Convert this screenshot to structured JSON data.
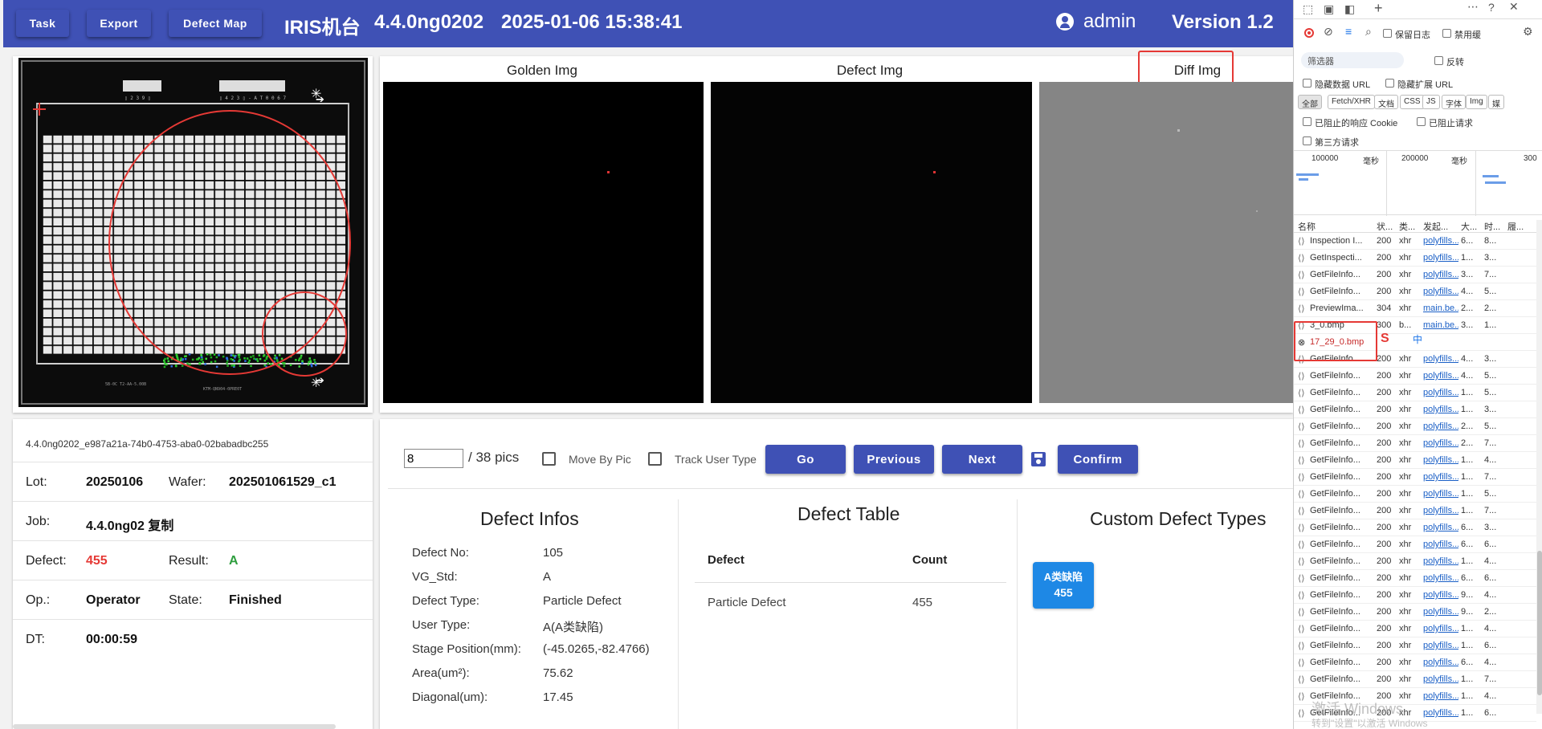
{
  "topbar": {
    "task_label": "Task",
    "export_label": "Export",
    "defect_map_label": "Defect Map",
    "machine": "IRIS机台",
    "recipe": "4.4.0ng0202",
    "datetime": "2025-01-06 15:38:41",
    "user": "admin",
    "version": "Version 1.2",
    "bg_color": "#3f51b5"
  },
  "wafer": {
    "barcode_left": "▯ 2 3 9 ▯",
    "barcode_right": "▯ 4 2 3 ▯ - A T 0 0 6 7",
    "bottom_left": "5B-0C T2-AA-5.00B",
    "bottom_right": "KTM-QN904-0PRE0T"
  },
  "viewer": {
    "golden_title": "Golden Img",
    "defect_title": "Defect Img",
    "diff_title": "Diff Img"
  },
  "info": {
    "id": "4.4.0ng0202_e987a21a-74b0-4753-aba0-02babadbc255",
    "lot_label": "Lot:",
    "lot": "20250106",
    "wafer_label": "Wafer:",
    "wafer": "202501061529_c1",
    "job_label": "Job:",
    "job": "4.4.0ng02 复制",
    "defect_label": "Defect:",
    "defect": "455",
    "result_label": "Result:",
    "result": "A",
    "op_label": "Op.:",
    "op": "Operator",
    "state_label": "State:",
    "state": "Finished",
    "dt_label": "DT:",
    "dt": "00:00:59",
    "defect_color": "#e53935",
    "result_color": "#2e9e3e"
  },
  "controls": {
    "pic_value": "8",
    "pic_total": "/ 38 pics",
    "move_by_pic": "Move By Pic",
    "track_user_type": "Track User Type",
    "go": "Go",
    "previous": "Previous",
    "next": "Next",
    "confirm": "Confirm"
  },
  "defect_infos": {
    "title": "Defect Infos",
    "rows": [
      {
        "label": "Defect No:",
        "value": "105"
      },
      {
        "label": "VG_Std:",
        "value": "A"
      },
      {
        "label": "Defect Type:",
        "value": "Particle Defect"
      },
      {
        "label": "User Type:",
        "value": "A(A类缺陷)"
      },
      {
        "label": "Stage Position(mm):",
        "value": "(-45.0265,-82.4766)"
      },
      {
        "label": "Area(um²):",
        "value": "75.62"
      },
      {
        "label": "Diagonal(um):",
        "value": "17.45"
      }
    ]
  },
  "defect_table": {
    "title": "Defect Table",
    "col_defect": "Defect",
    "col_count": "Count",
    "rows": [
      {
        "defect": "Particle Defect",
        "count": "455"
      }
    ]
  },
  "custom_types": {
    "title": "Custom Defect Types",
    "chip_name": "A类缺陷",
    "chip_count": "455",
    "chip_color": "#1e88e5"
  },
  "devtools": {
    "filter_placeholder": "筛选器",
    "invert": "反转",
    "preserve_log": "保留日志",
    "disable_cache": "禁用缓",
    "hide_data_url": "隐藏数据 URL",
    "hide_ext_url": "隐藏扩展 URL",
    "chips": [
      "全部",
      "Fetch/XHR",
      "文档",
      "CSS",
      "JS",
      "字体",
      "Img",
      "媒"
    ],
    "blocked_cookie": "已阻止的响应 Cookie",
    "blocked_req": "已阻止请求",
    "third_party": "第三方请求",
    "tl_1": "100000",
    "tl_2": "200000",
    "tl_3": "300",
    "tl_unit": "毫秒",
    "cols": {
      "name": "名称",
      "status": "状...",
      "type": "类...",
      "initiator": "发起...",
      "size": "大...",
      "time": "时...",
      "extra": "履..."
    },
    "rows": [
      {
        "name": "Inspection I...",
        "status": "200",
        "type": "xhr",
        "init": "polyfills...",
        "size": "6...",
        "time": "8..."
      },
      {
        "name": "GetInspecti...",
        "status": "200",
        "type": "xhr",
        "init": "polyfills...",
        "size": "1...",
        "time": "3..."
      },
      {
        "name": "GetFileInfo...",
        "status": "200",
        "type": "xhr",
        "init": "polyfills...",
        "size": "3...",
        "time": "7..."
      },
      {
        "name": "GetFileInfo...",
        "status": "200",
        "type": "xhr",
        "init": "polyfills...",
        "size": "4...",
        "time": "5..."
      },
      {
        "name": "PreviewIma...",
        "status": "304",
        "type": "xhr",
        "init": "main.be...",
        "size": "2...",
        "time": "2..."
      },
      {
        "name": "3_0.bmp",
        "status": "300",
        "type": "b...",
        "init": "main.be...",
        "size": "3...",
        "time": "1..."
      },
      {
        "name": "17_29_0.bmp",
        "status": "",
        "type": "",
        "init": "",
        "size": "",
        "time": "",
        "error": true
      },
      {
        "name": "GetFileInfo...",
        "status": "200",
        "type": "xhr",
        "init": "polyfills...",
        "size": "4...",
        "time": "3..."
      },
      {
        "name": "GetFileInfo...",
        "status": "200",
        "type": "xhr",
        "init": "polyfills...",
        "size": "4...",
        "time": "5..."
      },
      {
        "name": "GetFileInfo...",
        "status": "200",
        "type": "xhr",
        "init": "polyfills...",
        "size": "1...",
        "time": "5..."
      },
      {
        "name": "GetFileInfo...",
        "status": "200",
        "type": "xhr",
        "init": "polyfills...",
        "size": "1...",
        "time": "3..."
      },
      {
        "name": "GetFileInfo...",
        "status": "200",
        "type": "xhr",
        "init": "polyfills...",
        "size": "2...",
        "time": "5..."
      },
      {
        "name": "GetFileInfo...",
        "status": "200",
        "type": "xhr",
        "init": "polyfills...",
        "size": "2...",
        "time": "7..."
      },
      {
        "name": "GetFileInfo...",
        "status": "200",
        "type": "xhr",
        "init": "polyfills...",
        "size": "1...",
        "time": "4..."
      },
      {
        "name": "GetFileInfo...",
        "status": "200",
        "type": "xhr",
        "init": "polyfills...",
        "size": "1...",
        "time": "7..."
      },
      {
        "name": "GetFileInfo...",
        "status": "200",
        "type": "xhr",
        "init": "polyfills...",
        "size": "1...",
        "time": "5..."
      },
      {
        "name": "GetFileInfo...",
        "status": "200",
        "type": "xhr",
        "init": "polyfills...",
        "size": "1...",
        "time": "7..."
      },
      {
        "name": "GetFileInfo...",
        "status": "200",
        "type": "xhr",
        "init": "polyfills...",
        "size": "6...",
        "time": "3..."
      },
      {
        "name": "GetFileInfo...",
        "status": "200",
        "type": "xhr",
        "init": "polyfills...",
        "size": "6...",
        "time": "6..."
      },
      {
        "name": "GetFileInfo...",
        "status": "200",
        "type": "xhr",
        "init": "polyfills...",
        "size": "1...",
        "time": "4..."
      },
      {
        "name": "GetFileInfo...",
        "status": "200",
        "type": "xhr",
        "init": "polyfills...",
        "size": "6...",
        "time": "6..."
      },
      {
        "name": "GetFileInfo...",
        "status": "200",
        "type": "xhr",
        "init": "polyfills...",
        "size": "9...",
        "time": "4..."
      },
      {
        "name": "GetFileInfo...",
        "status": "200",
        "type": "xhr",
        "init": "polyfills...",
        "size": "9...",
        "time": "2..."
      },
      {
        "name": "GetFileInfo...",
        "status": "200",
        "type": "xhr",
        "init": "polyfills...",
        "size": "1...",
        "time": "4..."
      },
      {
        "name": "GetFileInfo...",
        "status": "200",
        "type": "xhr",
        "init": "polyfills...",
        "size": "1...",
        "time": "6..."
      },
      {
        "name": "GetFileInfo...",
        "status": "200",
        "type": "xhr",
        "init": "polyfills...",
        "size": "6...",
        "time": "4..."
      },
      {
        "name": "GetFileInfo...",
        "status": "200",
        "type": "xhr",
        "init": "polyfills...",
        "size": "1...",
        "time": "7..."
      },
      {
        "name": "GetFileInfo...",
        "status": "200",
        "type": "xhr",
        "init": "polyfills...",
        "size": "1...",
        "time": "4..."
      },
      {
        "name": "GetFileInfo...",
        "status": "200",
        "type": "xhr",
        "init": "polyfills...",
        "size": "1...",
        "time": "6..."
      }
    ],
    "sogou": "中"
  },
  "windows_watermark": "激活 Windows",
  "windows_watermark_sub": "转到\"设置\"以激活 Windows"
}
